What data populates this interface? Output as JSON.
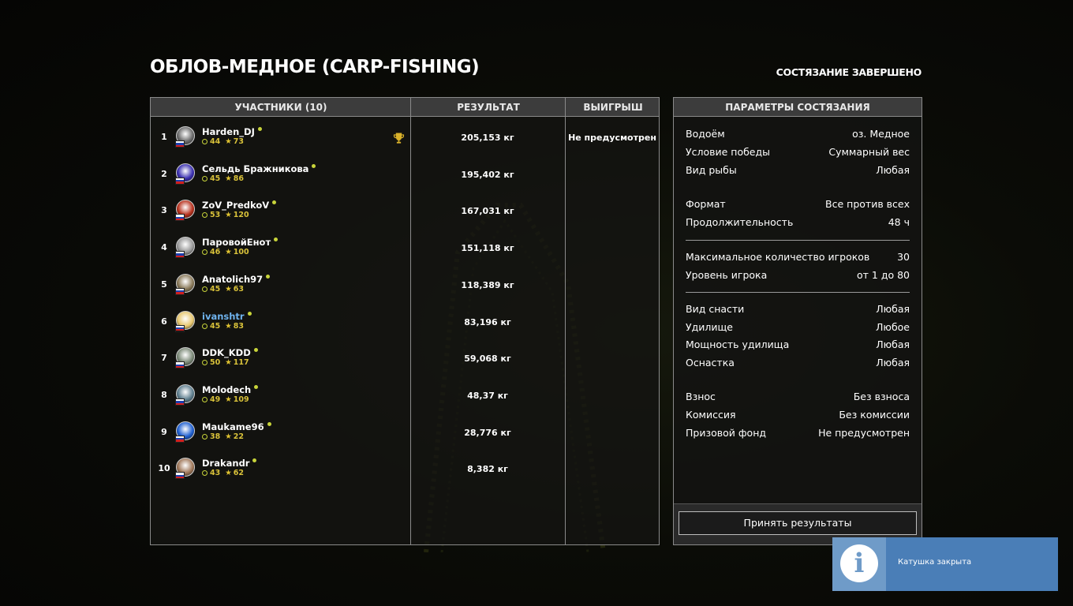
{
  "header": {
    "title": "ОБЛОВ-МЕДНОЕ (CARP-FISHING)",
    "status": "СОСТЯЗАНИЕ ЗАВЕРШЕНО"
  },
  "results": {
    "columns": {
      "participants": "УЧАСТНИКИ (10)",
      "result": "РЕЗУЛЬТАТ",
      "prize": "ВЫИГРЫШ"
    },
    "rows": [
      {
        "rank": "1",
        "name": "Harden_DJ",
        "level": "44",
        "stars": "73",
        "weight": "205,153 кг",
        "prize": "Не предусмотрен",
        "avatar_color": "#6b6b6b"
      },
      {
        "rank": "2",
        "name": "Сельдь Бражникова",
        "level": "45",
        "stars": "86",
        "weight": "195,402 кг",
        "prize": "",
        "avatar_color": "#3a2fb0"
      },
      {
        "rank": "3",
        "name": "ZoV_PredkoV",
        "level": "53",
        "stars": "120",
        "weight": "167,031 кг",
        "prize": "",
        "avatar_color": "#b8321e"
      },
      {
        "rank": "4",
        "name": "ПаровойЕнот",
        "level": "46",
        "stars": "100",
        "weight": "151,118 кг",
        "prize": "",
        "avatar_color": "#9a9a9a"
      },
      {
        "rank": "5",
        "name": "Anatolich97",
        "level": "45",
        "stars": "63",
        "weight": "118,389 кг",
        "prize": "",
        "avatar_color": "#8a7a5a"
      },
      {
        "rank": "6",
        "name": "ivanshtr",
        "level": "45",
        "stars": "83",
        "weight": "83,196 кг",
        "prize": "",
        "avatar_color": "#e8c870"
      },
      {
        "rank": "7",
        "name": "DDK_KDD",
        "level": "50",
        "stars": "117",
        "weight": "59,068 кг",
        "prize": "",
        "avatar_color": "#7c8a78"
      },
      {
        "rank": "8",
        "name": "Molodech",
        "level": "49",
        "stars": "109",
        "weight": "48,37 кг",
        "prize": "",
        "avatar_color": "#5f7f8f"
      },
      {
        "rank": "9",
        "name": "Maukame96",
        "level": "38",
        "stars": "22",
        "weight": "28,776 кг",
        "prize": "",
        "avatar_color": "#1f5fd0"
      },
      {
        "rank": "10",
        "name": "Drakandr",
        "level": "43",
        "stars": "62",
        "weight": "8,382 кг",
        "prize": "",
        "avatar_color": "#a0785a"
      }
    ]
  },
  "params": {
    "header": "ПАРАМЕТРЫ СОСТЯЗАНИЯ",
    "items": [
      {
        "key": "Водоём",
        "value": "оз. Медное"
      },
      {
        "key": "Условие победы",
        "value": "Суммарный вес"
      },
      {
        "key": "Вид рыбы",
        "value": "Любая"
      },
      {
        "key": "Формат",
        "value": "Все против всех"
      },
      {
        "key": "Продолжительность",
        "value": "48 ч"
      },
      {
        "key": "Максимальное количество игроков",
        "value": "30"
      },
      {
        "key": "Уровень игрока",
        "value": "от 1 до 80"
      },
      {
        "key": "Вид снасти",
        "value": "Любая"
      },
      {
        "key": "Удилище",
        "value": "Любое"
      },
      {
        "key": "Мощность удилища",
        "value": "Любая"
      },
      {
        "key": "Оснастка",
        "value": "Любая"
      },
      {
        "key": "Взнос",
        "value": "Без взноса"
      },
      {
        "key": "Комиссия",
        "value": "Без комиссии"
      },
      {
        "key": "Призовой фонд",
        "value": "Не предусмотрен"
      }
    ],
    "accept_label": "Принять результаты"
  },
  "toast": {
    "icon": "info-icon",
    "icon_glyph": "i",
    "message": "Катушка закрыта"
  },
  "colors": {
    "online": "#c8d43a",
    "stats": "#d9c23a",
    "highlight_name": "#6fb3ee",
    "toast_bg": "#4a7eb7"
  }
}
